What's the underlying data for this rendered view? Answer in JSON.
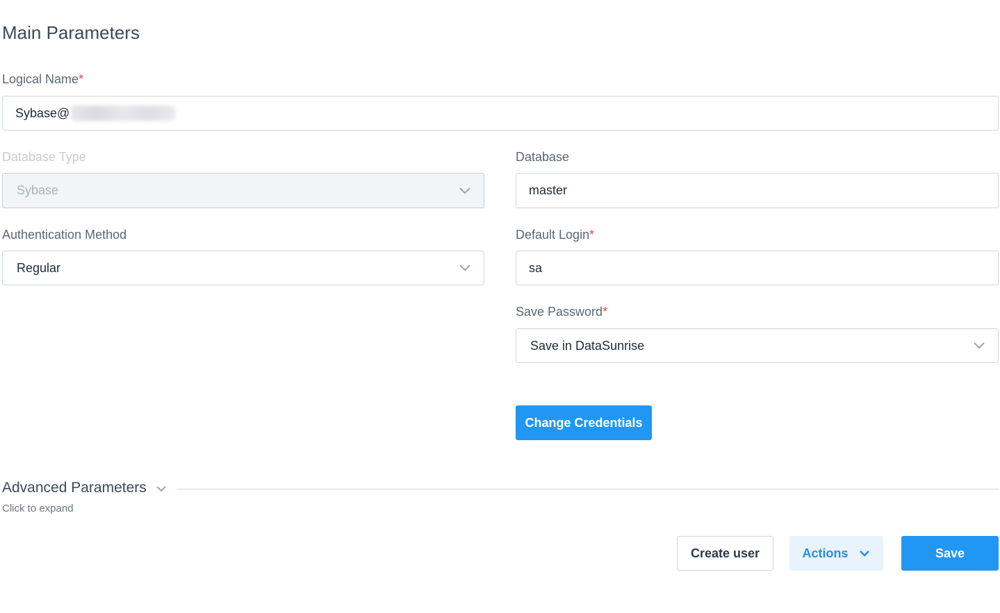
{
  "section_title": "Main Parameters",
  "logical_name": {
    "label": "Logical Name",
    "required_mark": "*",
    "value": "Sybase@"
  },
  "database_type": {
    "label": "Database Type",
    "value": "Sybase"
  },
  "database": {
    "label": "Database",
    "value": "master"
  },
  "auth_method": {
    "label": "Authentication Method",
    "value": "Regular"
  },
  "default_login": {
    "label": "Default Login",
    "required_mark": "*",
    "value": "sa"
  },
  "save_password": {
    "label": "Save Password",
    "required_mark": "*",
    "value": "Save in DataSunrise"
  },
  "change_credentials_label": "Change Credentials",
  "advanced": {
    "title": "Advanced Parameters",
    "subtitle": "Click to expand"
  },
  "footer": {
    "create_user": "Create user",
    "actions": "Actions",
    "save": "Save"
  },
  "colors": {
    "primary": "#2196f3",
    "required": "#e0454a",
    "soft_button_bg": "#e8f3fd"
  },
  "icons": {
    "select_arrow": "chevron-down-icon",
    "actions_arrow": "chevron-down-icon"
  }
}
